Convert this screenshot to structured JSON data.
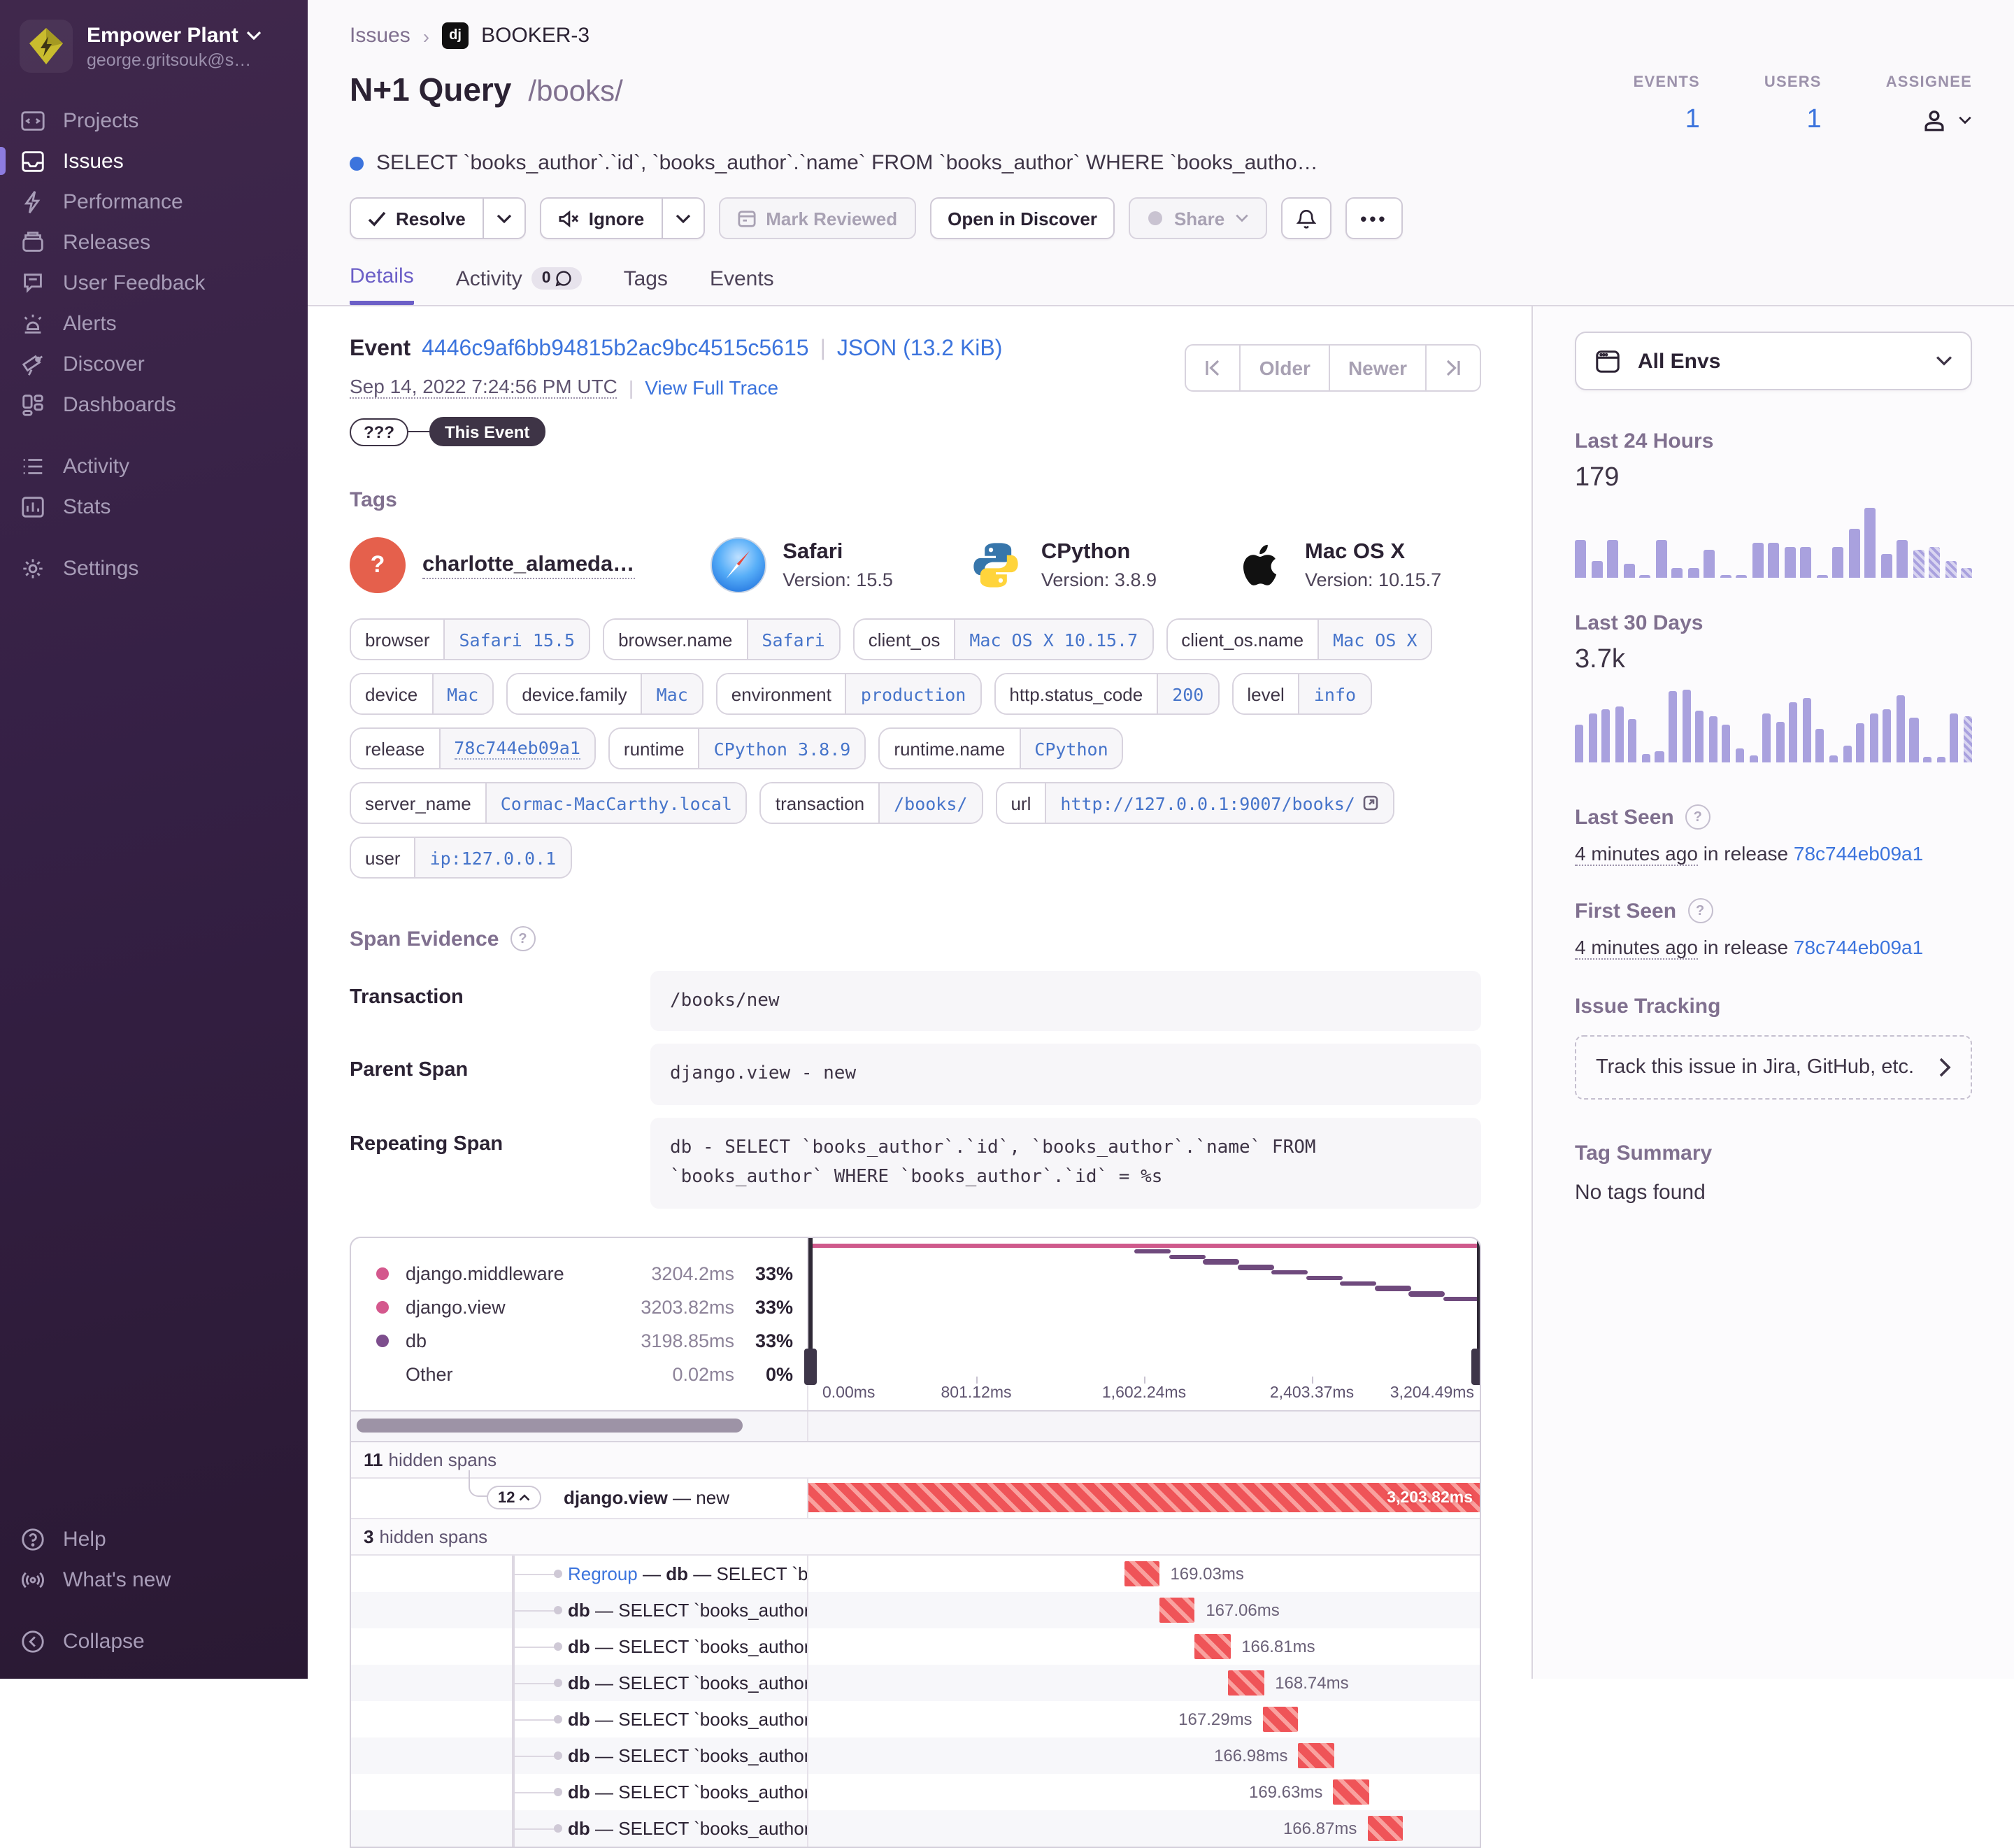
{
  "sidebar": {
    "org": {
      "name": "Empower Plant",
      "email": "george.gritsouk@s…"
    },
    "items": [
      {
        "label": "Projects",
        "icon": "projects-icon",
        "section": 0
      },
      {
        "label": "Issues",
        "icon": "issues-icon",
        "section": 0,
        "active": true
      },
      {
        "label": "Performance",
        "icon": "performance-icon",
        "section": 0
      },
      {
        "label": "Releases",
        "icon": "releases-icon",
        "section": 0
      },
      {
        "label": "User Feedback",
        "icon": "user-feedback-icon",
        "section": 0
      },
      {
        "label": "Alerts",
        "icon": "alerts-icon",
        "section": 0
      },
      {
        "label": "Discover",
        "icon": "discover-icon",
        "section": 0
      },
      {
        "label": "Dashboards",
        "icon": "dashboards-icon",
        "section": 0
      },
      {
        "label": "Activity",
        "icon": "activity-icon",
        "section": 1
      },
      {
        "label": "Stats",
        "icon": "stats-icon",
        "section": 1
      },
      {
        "label": "Settings",
        "icon": "settings-icon",
        "section": 2
      }
    ],
    "footer_items": [
      {
        "label": "Help",
        "icon": "help-icon",
        "section": 0
      },
      {
        "label": "What's new",
        "icon": "whats-new-icon",
        "section": 0
      },
      {
        "label": "Collapse",
        "icon": "collapse-icon",
        "section": 1
      }
    ]
  },
  "header": {
    "breadcrumb": {
      "root": "Issues",
      "project_badge": "dj",
      "issue_id": "BOOKER-3"
    },
    "title": "N+1 Query",
    "culprit": "/books/",
    "subtitle": "SELECT `books_author`.`id`, `books_author`.`name` FROM `books_author` WHERE `books_autho…",
    "actions": {
      "resolve": "Resolve",
      "ignore": "Ignore",
      "mark_reviewed": "Mark Reviewed",
      "open_in_discover": "Open in Discover",
      "share": "Share"
    },
    "tabs": [
      {
        "label": "Details",
        "active": true
      },
      {
        "label": "Activity",
        "badge": "0"
      },
      {
        "label": "Tags"
      },
      {
        "label": "Events"
      }
    ],
    "stats": {
      "events_label": "EVENTS",
      "events_value": "1",
      "users_label": "USERS",
      "users_value": "1",
      "assignee_label": "ASSIGNEE"
    }
  },
  "event": {
    "label": "Event",
    "id": "4446c9af6bb94815b2ac9bc4515c5615",
    "json_link": "JSON (13.2 KiB)",
    "timestamp": "Sep 14, 2022 7:24:56 PM UTC",
    "trace_link": "View Full Trace",
    "trace": {
      "unknown": "???",
      "current": "This Event"
    },
    "pagination": {
      "older": "Older",
      "newer": "Newer"
    }
  },
  "tags": {
    "heading": "Tags",
    "featured": [
      {
        "name": "charlotte_alameda…",
        "icon": "question-avatar",
        "sub": ""
      },
      {
        "name": "Safari",
        "icon": "safari-avatar",
        "sub": "Version: 15.5"
      },
      {
        "name": "CPython",
        "icon": "python-avatar",
        "sub": "Version: 3.8.9"
      },
      {
        "name": "Mac OS X",
        "icon": "apple-avatar",
        "sub": "Version: 10.15.7"
      }
    ],
    "pills": [
      {
        "key": "browser",
        "value": "Safari 15.5"
      },
      {
        "key": "browser.name",
        "value": "Safari"
      },
      {
        "key": "client_os",
        "value": "Mac OS X 10.15.7"
      },
      {
        "key": "client_os.name",
        "value": "Mac OS X"
      },
      {
        "key": "device",
        "value": "Mac"
      },
      {
        "key": "device.family",
        "value": "Mac"
      },
      {
        "key": "environment",
        "value": "production"
      },
      {
        "key": "http.status_code",
        "value": "200"
      },
      {
        "key": "level",
        "value": "info"
      },
      {
        "key": "release",
        "value": "78c744eb09a1",
        "release": true
      },
      {
        "key": "runtime",
        "value": "CPython 3.8.9"
      },
      {
        "key": "runtime.name",
        "value": "CPython"
      },
      {
        "key": "server_name",
        "value": "Cormac-MacCarthy.local"
      },
      {
        "key": "transaction",
        "value": "/books/"
      },
      {
        "key": "url",
        "value": "http://127.0.0.1:9007/books/",
        "external": true
      },
      {
        "key": "user",
        "value": "ip:127.0.0.1"
      }
    ]
  },
  "span_evidence": {
    "heading": "Span Evidence",
    "rows": [
      {
        "label": "Transaction",
        "value": "/books/new"
      },
      {
        "label": "Parent Span",
        "value": "django.view - new"
      },
      {
        "label": "Repeating Span",
        "value": "db - SELECT `books_author`.`id`, `books_author`.`name` FROM `books_author` WHERE `books_author`.`id` = %s"
      }
    ]
  },
  "waterfall": {
    "legend": [
      {
        "name": "django.middleware",
        "time": "3204.2ms",
        "pct": "33%",
        "color": "#d4588d"
      },
      {
        "name": "django.view",
        "time": "3203.82ms",
        "pct": "33%",
        "color": "#d4588d"
      },
      {
        "name": "db",
        "time": "3198.85ms",
        "pct": "33%",
        "color": "#7d4e8d"
      },
      {
        "name": "Other",
        "time": "0.02ms",
        "pct": "0%",
        "color": ""
      }
    ],
    "axis": [
      "0.00ms",
      "801.12ms",
      "1,602.24ms",
      "2,403.37ms",
      "3,204.49ms"
    ],
    "minimap": {
      "line_color": "#cf5a8c",
      "dash_color": "#6f4a7d",
      "steps": [
        48.6,
        53.7,
        58.8,
        63.9,
        69.0,
        74.1,
        79.2,
        84.3,
        89.4,
        94.6
      ],
      "dash_width": 5.4
    },
    "hidden_above": {
      "count": "11",
      "label": "hidden spans"
    },
    "group_row": {
      "count": "12",
      "op": "django.view",
      "desc": "new",
      "duration": "3,203.82ms"
    },
    "hidden_mid": {
      "count": "3",
      "label": "hidden spans"
    },
    "rows": [
      {
        "link": "Regroup",
        "op": "db",
        "desc": "SELECT `boo",
        "duration": "169.03ms",
        "start": 47.0,
        "side": "right"
      },
      {
        "link": "",
        "op": "db",
        "desc": "SELECT `books_author`",
        "duration": "167.06ms",
        "start": 52.3,
        "side": "right"
      },
      {
        "link": "",
        "op": "db",
        "desc": "SELECT `books_author`",
        "duration": "166.81ms",
        "start": 57.6,
        "side": "right"
      },
      {
        "link": "",
        "op": "db",
        "desc": "SELECT `books_author`",
        "duration": "168.74ms",
        "start": 62.6,
        "side": "right"
      },
      {
        "link": "",
        "op": "db",
        "desc": "SELECT `books_author`",
        "duration": "167.29ms",
        "start": 67.7,
        "side": "left"
      },
      {
        "link": "",
        "op": "db",
        "desc": "SELECT `books_author`",
        "duration": "166.98ms",
        "start": 73.0,
        "side": "left"
      },
      {
        "link": "",
        "op": "db",
        "desc": "SELECT `books_author`",
        "duration": "169.63ms",
        "start": 78.2,
        "side": "left"
      },
      {
        "link": "",
        "op": "db",
        "desc": "SELECT `books_author`",
        "duration": "166.87ms",
        "start": 83.3,
        "side": "left"
      }
    ],
    "bar_width_pct": 5.3
  },
  "rail": {
    "env_filter": "All Envs",
    "last24": {
      "label": "Last 24 Hours",
      "value": "179"
    },
    "last30": {
      "label": "Last 30 Days",
      "value": "3.7k"
    },
    "last_seen": {
      "label": "Last Seen",
      "ago": "4 minutes ago",
      "prefix": "in release",
      "release": "78c744eb09a1"
    },
    "first_seen": {
      "label": "First Seen",
      "ago": "4 minutes ago",
      "prefix": "in release",
      "release": "78c744eb09a1"
    },
    "issue_tracking": {
      "heading": "Issue Tracking",
      "button": "Track this issue in Jira, GitHub, etc."
    },
    "tag_summary": {
      "heading": "Tag Summary",
      "empty": "No tags found"
    }
  },
  "chart_data": [
    {
      "type": "bar",
      "title": "Last 24 Hours",
      "total_label": "179",
      "values": [
        11,
        5,
        11,
        4,
        1,
        11,
        3,
        3,
        8,
        1,
        1,
        10,
        10,
        9,
        9,
        1,
        9,
        14,
        20,
        7,
        11,
        8,
        9,
        5,
        3
      ],
      "hatched_from": 21,
      "ylim": [
        0,
        20
      ]
    },
    {
      "type": "bar",
      "title": "Last 30 Days",
      "total_label": "3.7k",
      "values": [
        95,
        124,
        137,
        143,
        110,
        23,
        29,
        181,
        185,
        133,
        118,
        95,
        34,
        19,
        124,
        105,
        152,
        162,
        86,
        19,
        42,
        99,
        124,
        137,
        171,
        114,
        13,
        13,
        124,
        118
      ],
      "hatched_from": 29,
      "ylim": [
        0,
        185
      ]
    }
  ]
}
